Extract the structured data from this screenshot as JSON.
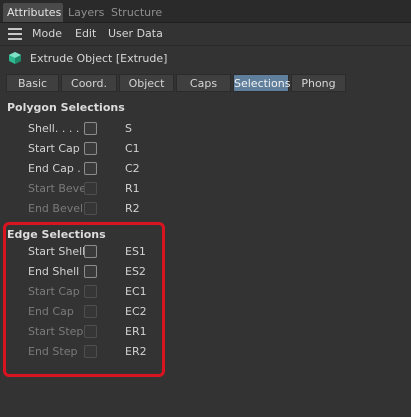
{
  "top_tabs": [
    "Attributes",
    "Layers",
    "Structure"
  ],
  "menu": [
    "Mode",
    "Edit",
    "User Data"
  ],
  "object_title": "Extrude Object [Extrude]",
  "sub_tabs": [
    "Basic",
    "Coord.",
    "Object",
    "Caps",
    "Selections",
    "Phong"
  ],
  "active_sub_tab": "Selections",
  "polygon_selections": {
    "title": "Polygon Selections",
    "rows": [
      {
        "label": "Shell. . . . .",
        "value": "S",
        "enabled": true
      },
      {
        "label": "Start Cap",
        "value": "C1",
        "enabled": true
      },
      {
        "label": "End Cap .",
        "value": "C2",
        "enabled": true
      },
      {
        "label": "Start Bevel",
        "value": "R1",
        "enabled": false
      },
      {
        "label": "End Bevel",
        "value": "R2",
        "enabled": false
      }
    ]
  },
  "edge_selections": {
    "title": "Edge Selections",
    "rows": [
      {
        "label": "Start Shell",
        "value": "ES1",
        "enabled": true
      },
      {
        "label": "End Shell",
        "value": "ES2",
        "enabled": true
      },
      {
        "label": "Start Cap",
        "value": "EC1",
        "enabled": false
      },
      {
        "label": "End Cap",
        "value": "EC2",
        "enabled": false
      },
      {
        "label": "Start Step",
        "value": "ER1",
        "enabled": false
      },
      {
        "label": "End Step",
        "value": "ER2",
        "enabled": false
      }
    ]
  },
  "colors": {
    "accent_tab": "#5f7f9c",
    "highlight_box": "#d7141f",
    "object_icon": "#2fb890"
  },
  "icons": {
    "menu": "hamburger-icon",
    "object": "extrude-object-icon"
  }
}
